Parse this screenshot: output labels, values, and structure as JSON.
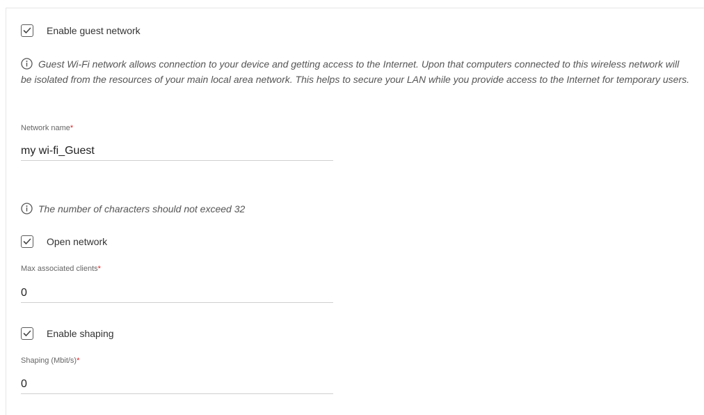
{
  "guest_network": {
    "enable_label": "Enable guest network",
    "enabled": true,
    "info_text": "Guest Wi-Fi network allows connection to your device and getting access to the Internet. Upon that computers connected to this wireless network will be isolated from the resources of your main local area network. This helps to secure your LAN while you provide access to the Internet for temporary users."
  },
  "network_name": {
    "label": "Network name",
    "required_mark": "*",
    "value": "my wi-fi_Guest",
    "hint": "The number of characters should not exceed 32"
  },
  "open_network": {
    "label": "Open network",
    "checked": true
  },
  "max_clients": {
    "label": "Max associated clients",
    "required_mark": "*",
    "value": "0"
  },
  "shaping": {
    "enable_label": "Enable shaping",
    "enabled": true,
    "label": "Shaping (Mbit/s)",
    "required_mark": "*",
    "value": "0"
  },
  "icons": {
    "checkbox": "checkmark-icon",
    "info": "info-icon"
  },
  "colors": {
    "required": "#e02020",
    "input_underline": "#cfcfcf",
    "checkbox_border": "#5a5a5a"
  }
}
